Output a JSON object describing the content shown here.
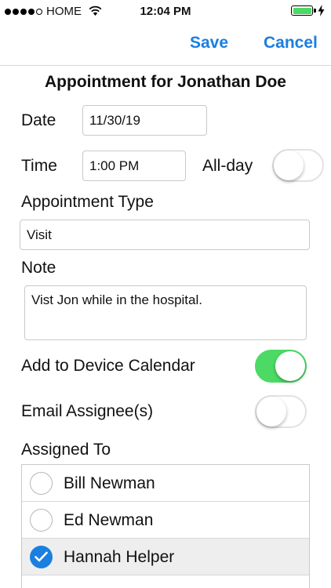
{
  "status_bar": {
    "carrier": "HOME",
    "time": "12:04 PM",
    "signal_bars_filled": 4,
    "signal_bars_total": 5,
    "battery_level": 1.0,
    "battery_color": "#4cd964",
    "charging": true
  },
  "nav": {
    "save_label": "Save",
    "cancel_label": "Cancel",
    "accent_color": "#1a7fe0"
  },
  "form": {
    "title": "Appointment for Jonathan Doe",
    "date_label": "Date",
    "date_value": "11/30/19",
    "time_label": "Time",
    "time_value": "1:00 PM",
    "allday_label": "All-day",
    "allday_on": false,
    "type_label": "Appointment Type",
    "type_value": "Visit",
    "note_label": "Note",
    "note_value": "Vist Jon while in the hospital.",
    "device_calendar_label": "Add to Device Calendar",
    "device_calendar_on": true,
    "email_label": "Email Assignee(s)",
    "email_on": false,
    "assigned_label": "Assigned To",
    "assignees": [
      {
        "name": "Bill Newman",
        "checked": false
      },
      {
        "name": "Ed Newman",
        "checked": false
      },
      {
        "name": "Hannah Helper",
        "checked": true
      }
    ]
  }
}
